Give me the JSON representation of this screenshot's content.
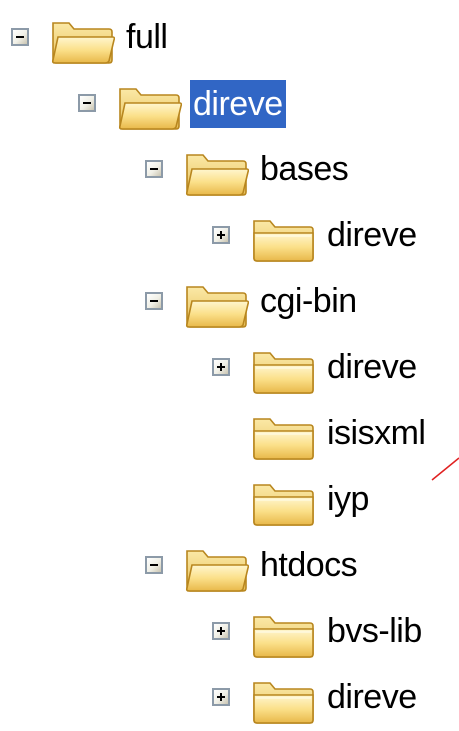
{
  "tree": {
    "nodes": [
      {
        "label": "full",
        "depth": 0,
        "toggle": "minus",
        "open": true,
        "selected": false
      },
      {
        "label": "direve",
        "depth": 1,
        "toggle": "minus",
        "open": true,
        "selected": true
      },
      {
        "label": "bases",
        "depth": 2,
        "toggle": "minus",
        "open": true,
        "selected": false
      },
      {
        "label": "direve",
        "depth": 3,
        "toggle": "plus",
        "open": false,
        "selected": false
      },
      {
        "label": "cgi-bin",
        "depth": 2,
        "toggle": "minus",
        "open": true,
        "selected": false
      },
      {
        "label": "direve",
        "depth": 3,
        "toggle": "plus",
        "open": false,
        "selected": false
      },
      {
        "label": "isisxml",
        "depth": 3,
        "toggle": "none",
        "open": false,
        "selected": false
      },
      {
        "label": "iyp",
        "depth": 3,
        "toggle": "none",
        "open": false,
        "selected": false
      },
      {
        "label": "htdocs",
        "depth": 2,
        "toggle": "minus",
        "open": true,
        "selected": false
      },
      {
        "label": "bvs-lib",
        "depth": 3,
        "toggle": "plus",
        "open": false,
        "selected": false
      },
      {
        "label": "direve",
        "depth": 3,
        "toggle": "plus",
        "open": false,
        "selected": false
      }
    ]
  },
  "colors": {
    "selection": "#3166c5",
    "annotation": "#e02020"
  }
}
